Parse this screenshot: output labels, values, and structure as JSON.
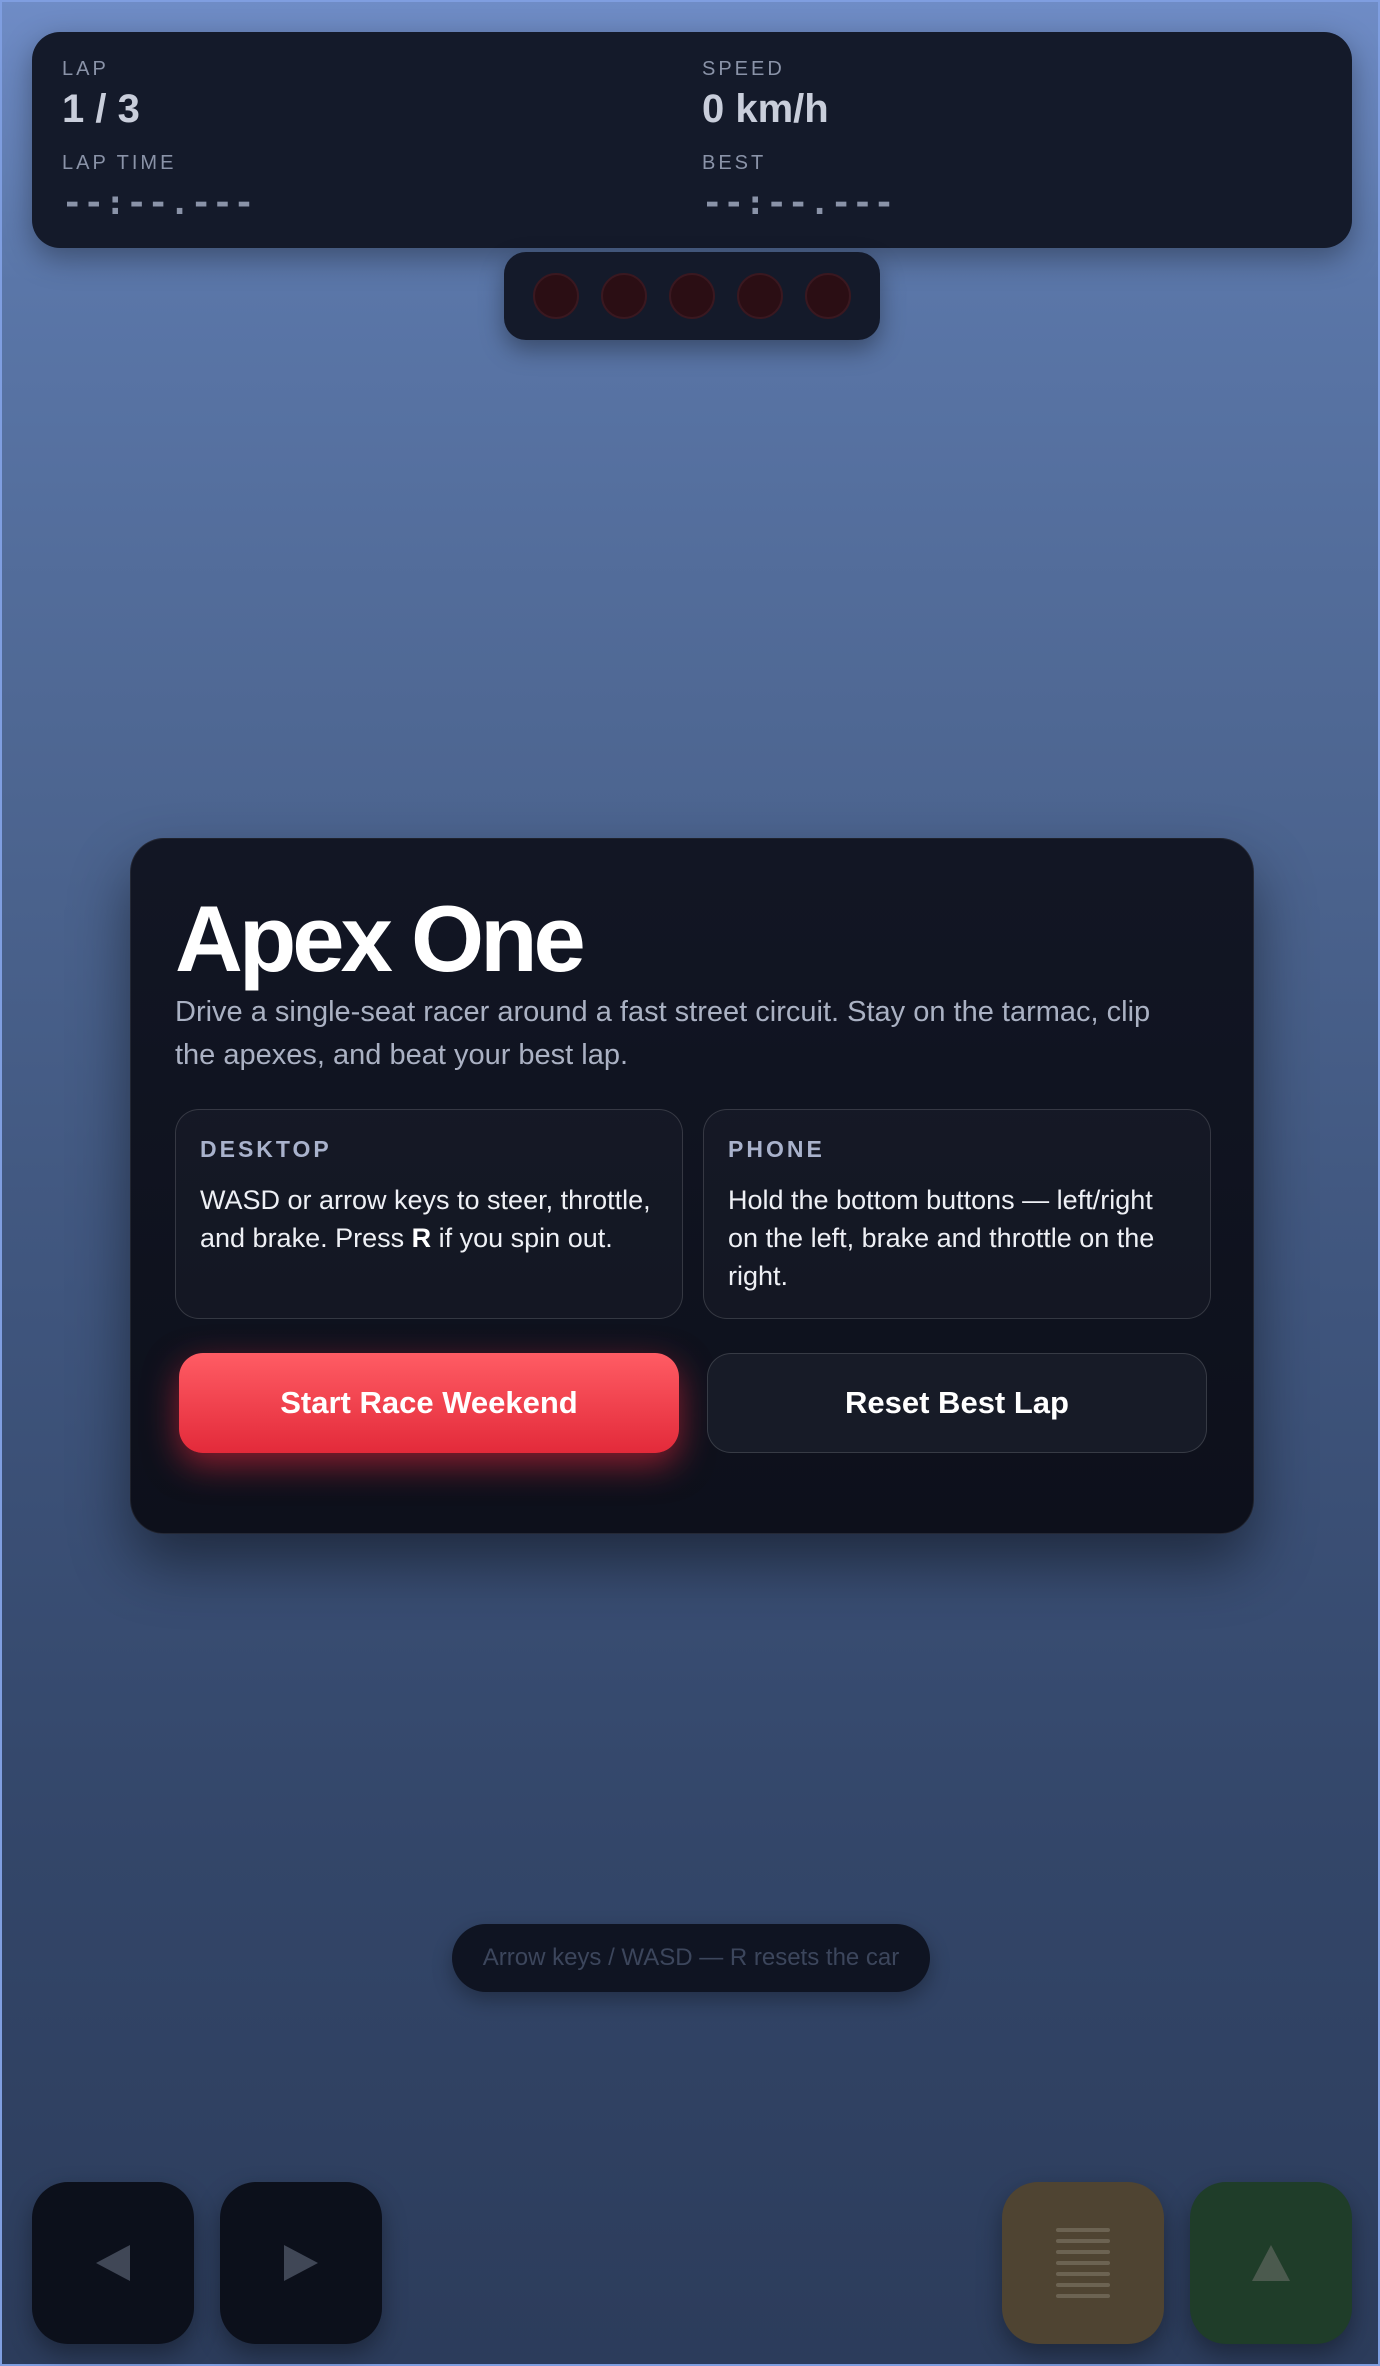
{
  "hud": {
    "lap_label": "LAP",
    "lap_value": "1 / 3",
    "speed_label": "SPEED",
    "speed_value": "0 km/h",
    "lap_time_label": "LAP TIME",
    "lap_time_value": "--:--.---",
    "best_label": "BEST",
    "best_value": "--:--.---"
  },
  "start_lights": {
    "count": 5,
    "lit": 0,
    "off_color": "#2b0e14"
  },
  "modal": {
    "title": "Apex One",
    "description": "Drive a single-seat racer around a fast street circuit. Stay on the tarmac, clip the apexes, and beat your best lap.",
    "desktop": {
      "heading": "DESKTOP",
      "text_before": "WASD or arrow keys to steer, throttle, and brake. Press ",
      "key": "R",
      "text_after": " if you spin out."
    },
    "phone": {
      "heading": "PHONE",
      "text": "Hold the bottom buttons — left/right on the left, brake and throttle on the right."
    },
    "start_button": "Start Race Weekend",
    "reset_button": "Reset Best Lap"
  },
  "hint": "Arrow keys / WASD — R resets the car",
  "controls": {
    "left_icon": "arrow-left-icon",
    "right_icon": "arrow-right-icon",
    "brake_icon": "brake-pedal-icon",
    "throttle_icon": "arrow-up-icon"
  },
  "colors": {
    "accent": "#e32a3a",
    "panel": "#141a2a",
    "brake": "#4f4432",
    "throttle": "#1f3d29"
  }
}
